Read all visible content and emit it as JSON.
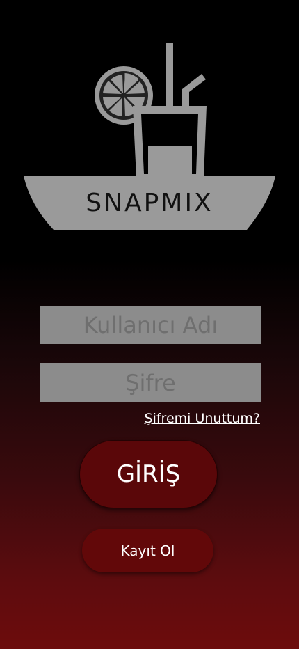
{
  "brand": {
    "name": "SNAPMIX",
    "logo_color": "#9a9a9a"
  },
  "form": {
    "username_placeholder": "Kullanıcı Adı",
    "password_placeholder": "Şifre",
    "forgot_password": "Şifremi Unuttum?",
    "login_label": "GİRİŞ",
    "register_label": "Kayıt Ol"
  },
  "colors": {
    "field_bg": "#8c8c8c",
    "button_primary": "#5a0709",
    "gradient_bottom": "#6d0c0c"
  }
}
